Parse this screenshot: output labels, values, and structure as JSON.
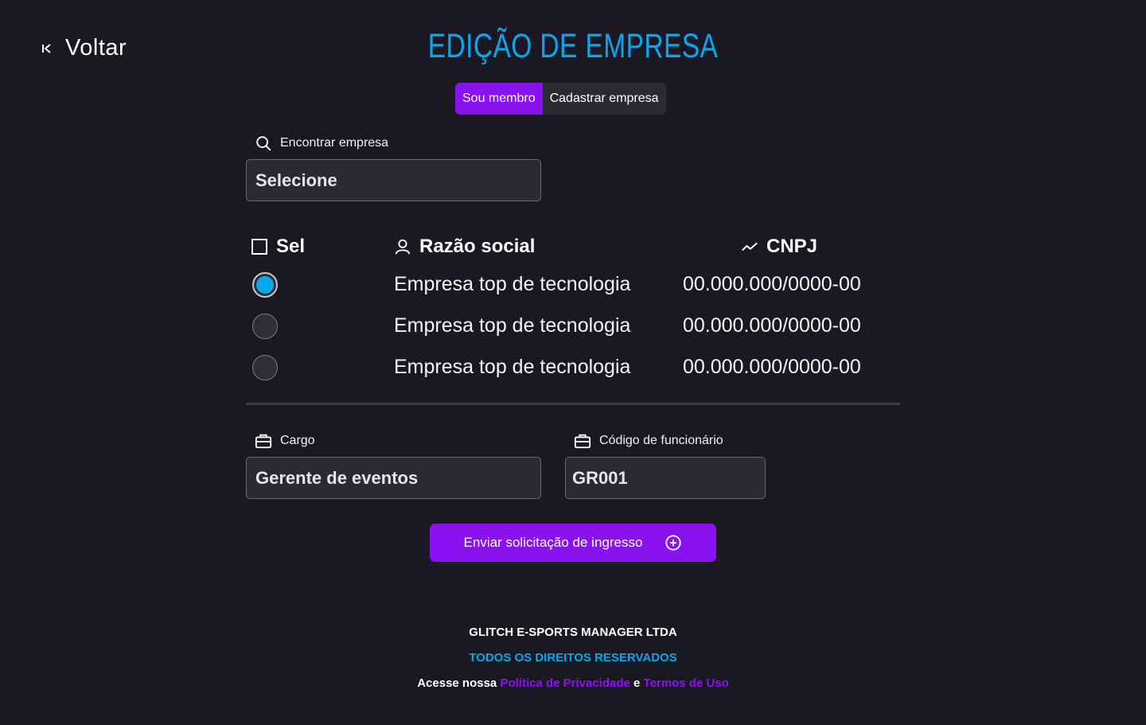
{
  "header": {
    "back_label": "Voltar",
    "title": "EDIÇÃO DE EMPRESA"
  },
  "tabs": [
    {
      "label": "Sou membro",
      "active": true
    },
    {
      "label": "Cadastrar empresa",
      "active": false
    }
  ],
  "search": {
    "label": "Encontrar empresa",
    "value": "Selecione",
    "icon": "search-icon"
  },
  "table": {
    "columns": [
      {
        "label": "Sel",
        "icon": "checkbox-icon"
      },
      {
        "label": "Razão social",
        "icon": "user-icon"
      },
      {
        "label": "CNPJ",
        "icon": "trend-icon"
      }
    ],
    "rows": [
      {
        "selected": true,
        "razao_social": "Empresa top de tecnologia",
        "cnpj": "00.000.000/0000-00"
      },
      {
        "selected": false,
        "razao_social": "Empresa top de tecnologia",
        "cnpj": "00.000.000/0000-00"
      },
      {
        "selected": false,
        "razao_social": "Empresa top de tecnologia",
        "cnpj": "00.000.000/0000-00"
      }
    ]
  },
  "form": {
    "cargo": {
      "label": "Cargo",
      "value": "Gerente de eventos",
      "icon": "briefcase-icon"
    },
    "codigo": {
      "label": "Código de funcionário",
      "value": "GR001",
      "icon": "briefcase-icon"
    }
  },
  "submit": {
    "label": "Enviar solicitação de ingresso",
    "icon": "plus-circle-icon"
  },
  "footer": {
    "company": "GLITCH E-SPORTS MANAGER LTDA",
    "rights": "TODOS OS DIREITOS RESERVADOS",
    "access_prefix": "Acesse nossa",
    "privacy": "Política de Privacidade",
    "conjunction": "e",
    "terms": "Termos de Uso"
  },
  "colors": {
    "background": "#1a1923",
    "accent_purple": "#8a12f0",
    "accent_blue": "#0aa6ea",
    "input_bg": "#2b2a33"
  }
}
